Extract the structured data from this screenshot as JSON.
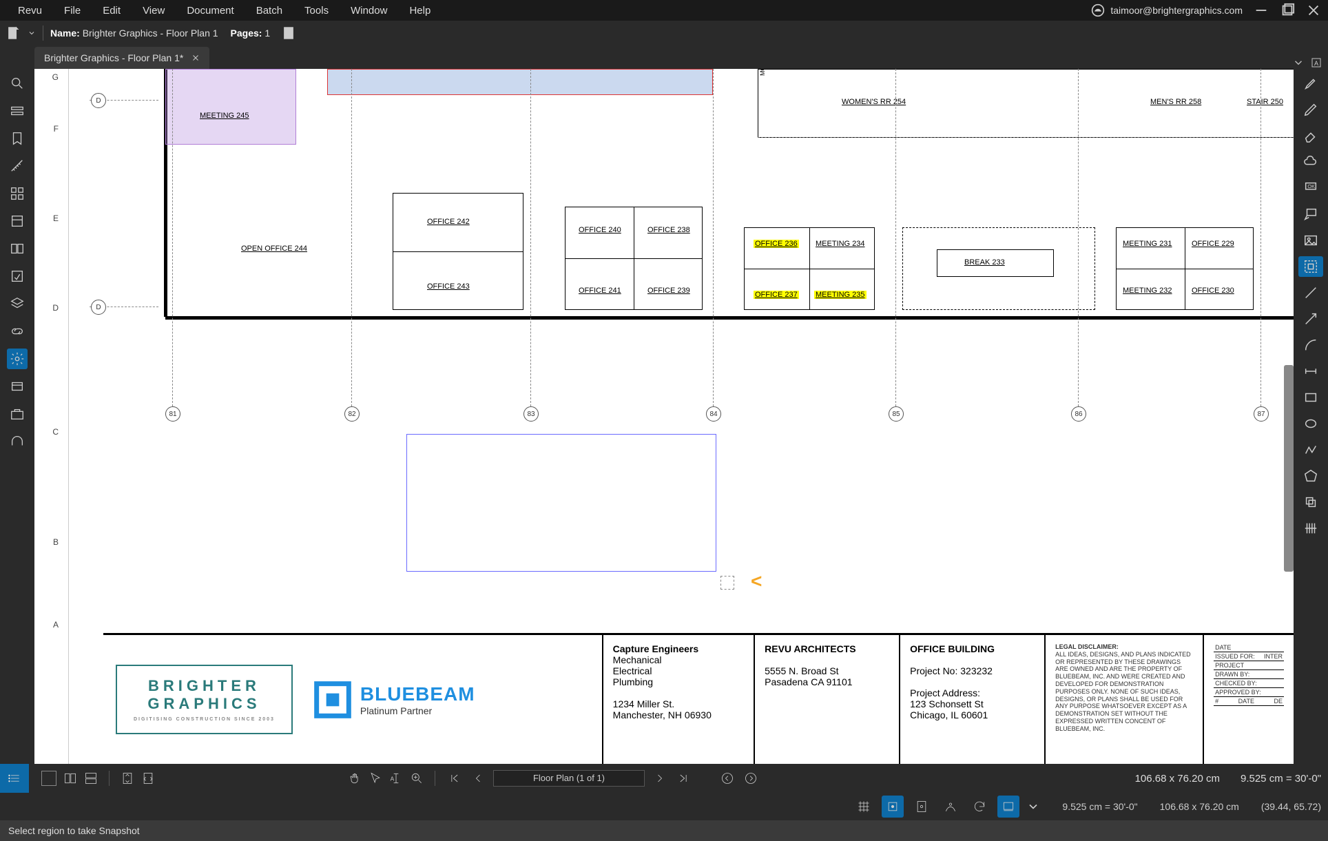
{
  "menu": {
    "items": [
      "Revu",
      "File",
      "Edit",
      "View",
      "Document",
      "Batch",
      "Tools",
      "Window",
      "Help"
    ],
    "user_email": "taimoor@brightergraphics.com"
  },
  "docbar": {
    "name_label": "Name:",
    "name_value": "Brighter Graphics - Floor Plan 1",
    "pages_label": "Pages:",
    "pages_value": "1"
  },
  "tab": {
    "title": "Brighter Graphics - Floor Plan 1*"
  },
  "ruler": {
    "labels": [
      "G",
      "F",
      "E",
      "D",
      "C",
      "B",
      "A"
    ]
  },
  "grid_bubbles": [
    "81",
    "82",
    "83",
    "84",
    "85",
    "86",
    "87"
  ],
  "rooms": {
    "meeting245": "MEETING   245",
    "openoffice244": "OPEN OFFICE   244",
    "office242": "OFFICE   242",
    "office243": "OFFICE   243",
    "office240": "OFFICE   240",
    "office241": "OFFICE   241",
    "office238": "OFFICE   238",
    "office239": "OFFICE   239",
    "office236": "OFFICE   236",
    "office237": "OFFICE   237",
    "meeting234": "MEETING   234",
    "meeting235": "MEETING   235",
    "break233": "BREAK   233",
    "meeting231": "MEETING   231",
    "meeting232": "MEETING   232",
    "office229": "OFFICE   229",
    "office230": "OFFICE   230",
    "womensrr": "WOMEN'S RR   254",
    "mensrr": "MEN'S RR   258",
    "stair250": "STAIR   250",
    "mothers": "MOTHER'S RM"
  },
  "titleblock": {
    "brighter": {
      "line1": "BRIGHTER",
      "line2": "GRAPHICS",
      "tag": "DIGITISING CONSTRUCTION SINCE 2003"
    },
    "bluebeam": {
      "name": "BLUEBEAM",
      "sub": "Platinum Partner"
    },
    "engineers": {
      "title": "Capture Engineers",
      "l1": "Mechanical",
      "l2": "Electrical",
      "l3": "Plumbing",
      "addr1": "1234 Miller St.",
      "addr2": "Manchester, NH 06930"
    },
    "architects": {
      "title": "REVU ARCHITECTS",
      "addr1": "5555 N. Broad St",
      "addr2": "Pasadena CA 91101"
    },
    "project": {
      "title": "OFFICE BUILDING",
      "pn": "Project No: 323232",
      "pah": "Project Address:",
      "pa1": "123 Schonsett St",
      "pa2": "Chicago, IL 60601"
    },
    "legal": {
      "h": "LEGAL DISCLAIMER:",
      "body": "ALL IDEAS, DESIGNS, AND PLANS INDICATED OR REPRESENTED BY THESE DRAWINGS ARE OWNED AND ARE THE PROPERTY OF BLUEBEAM, INC. AND WERE CREATED AND DEVELOPED FOR DEMONSTRATION PURPOSES ONLY. NONE OF SUCH IDEAS, DESIGNS, OR PLANS SHALL BE USED FOR ANY PURPOSE WHATSOEVER EXCEPT AS A DEMONSTRATION SET WITHOUT THE EXPRESSED WRITTEN CONCENT OF BLUEBEAM, INC."
    },
    "rev": {
      "r1": "DATE",
      "r1v": "",
      "r2": "ISSUED FOR:",
      "r2v": "INTER",
      "r3": "PROJECT",
      "r4": "DRAWN BY:",
      "r5": "CHECKED BY:",
      "r6": "APPROVED BY:",
      "r7a": "#",
      "r7b": "DATE",
      "r7c": "DE"
    }
  },
  "navbar": {
    "page_display": "Floor Plan (1 of 1)",
    "dim1": "106.68 x 76.20 cm",
    "dim2": "9.525 cm = 30'-0\""
  },
  "status1": {
    "r1": "9.525 cm = 30'-0\"",
    "r2": "106.68 x 76.20 cm",
    "r3": "(39.44, 65.72)"
  },
  "hint": "Select region to take Snapshot"
}
